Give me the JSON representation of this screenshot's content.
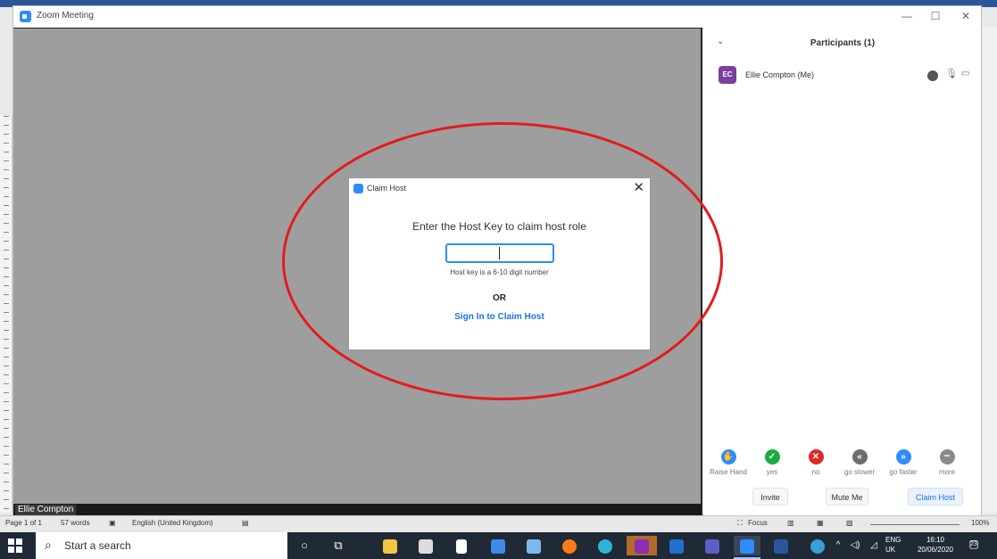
{
  "zoom": {
    "window_title": "Zoom Meeting",
    "self_name_tag": "Ellie Compton",
    "claim_dialog": {
      "title": "Claim Host",
      "prompt": "Enter the Host Key to claim host role",
      "input_value": "",
      "hint": "Host key is a 6-10 digit number",
      "or_text": "OR",
      "signin_link": "Sign In to Claim Host"
    },
    "participants": {
      "title": "Participants (1)",
      "items": [
        {
          "initials": "EC",
          "name": "Ellie Compton (Me)",
          "avatar_color": "#7b3fa0"
        }
      ],
      "reactions": [
        {
          "label": "Raise Hand",
          "icon": "hand-icon",
          "color": "#2d8cff",
          "glyph": "✋"
        },
        {
          "label": "yes",
          "icon": "check-icon",
          "color": "#1aab3f",
          "glyph": "✓"
        },
        {
          "label": "no",
          "icon": "x-icon",
          "color": "#e02828",
          "glyph": "✕"
        },
        {
          "label": "go slower",
          "icon": "rewind-icon",
          "color": "#6e6e6e",
          "glyph": "«"
        },
        {
          "label": "go faster",
          "icon": "fast-forward-icon",
          "color": "#2d8cff",
          "glyph": "»"
        },
        {
          "label": "more",
          "icon": "more-icon",
          "color": "#8a8a8a",
          "glyph": "•••"
        }
      ],
      "buttons": {
        "invite": "Invite",
        "mute_me": "Mute Me",
        "claim_host": "Claim Host"
      }
    }
  },
  "word_status": {
    "page": "Page 1 of 1",
    "words": "57 words",
    "language": "English (United Kingdom)",
    "focus": "Focus",
    "zoom_level": "100%"
  },
  "taskbar": {
    "search_placeholder": "Start a search",
    "lang_line1": "ENG",
    "lang_line2": "UK",
    "time": "16:10",
    "date": "20/06/2020",
    "notification_count": "23"
  },
  "colors": {
    "zoom_blue": "#2d8cff",
    "annotation_red": "#e31b1b",
    "video_bg": "#9e9e9e"
  }
}
